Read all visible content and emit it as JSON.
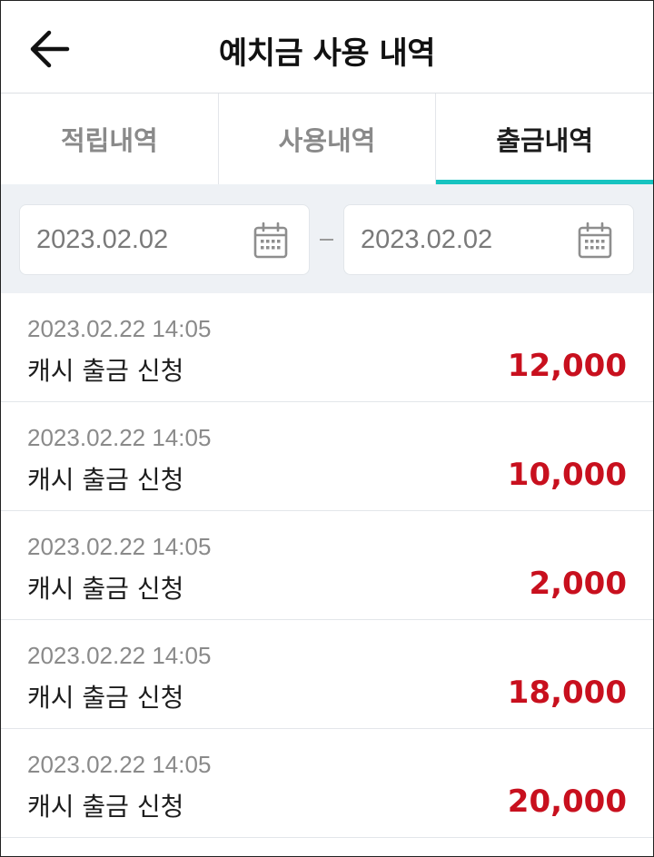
{
  "header": {
    "title": "예치금 사용 내역",
    "back_icon": "arrow-left-icon"
  },
  "tabs": [
    {
      "label": "적립내역",
      "active": false
    },
    {
      "label": "사용내역",
      "active": false
    },
    {
      "label": "출금내역",
      "active": true
    }
  ],
  "filter": {
    "start_date": "2023.02.02",
    "end_date": "2023.02.02",
    "calendar_icon": "calendar-icon"
  },
  "colors": {
    "accent": "#17c3c0",
    "amount": "#c8101e",
    "filter_bg": "#eef1f5"
  },
  "records": [
    {
      "datetime": "2023.02.22 14:05",
      "label": "캐시 출금 신청",
      "amount": "12,000"
    },
    {
      "datetime": "2023.02.22 14:05",
      "label": "캐시 출금 신청",
      "amount": "10,000"
    },
    {
      "datetime": "2023.02.22 14:05",
      "label": "캐시 출금 신청",
      "amount": "2,000"
    },
    {
      "datetime": "2023.02.22 14:05",
      "label": "캐시 출금 신청",
      "amount": "18,000"
    },
    {
      "datetime": "2023.02.22 14:05",
      "label": "캐시 출금 신청",
      "amount": "20,000"
    }
  ]
}
